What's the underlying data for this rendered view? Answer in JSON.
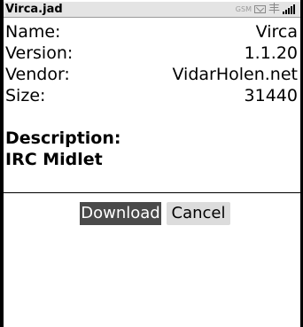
{
  "titlebar": {
    "title": "Virca.jad",
    "network_indicator": "GSM",
    "icons": [
      "message-icon",
      "antenna-icon",
      "signal-strength-icon"
    ]
  },
  "details": [
    {
      "label": "Name:",
      "value": "Virca"
    },
    {
      "label": "Version:",
      "value": "1.1.20"
    },
    {
      "label": "Vendor:",
      "value": "VidarHolen.net"
    },
    {
      "label": "Size:",
      "value": "31440"
    }
  ],
  "description": {
    "label": "Description:",
    "value": "IRC Midlet"
  },
  "actions": {
    "download_label": "Download",
    "cancel_label": "Cancel"
  },
  "colors": {
    "titlebar_bg": "#e4e4e4",
    "selected_button_bg": "#4a4a4a",
    "button_bg": "#dcdcdc"
  }
}
